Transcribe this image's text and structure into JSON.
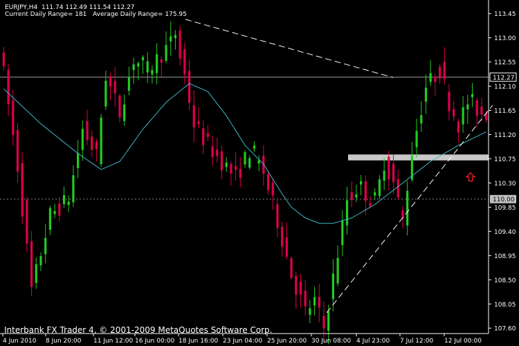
{
  "header": {
    "line1": "EURJPY,H4  111.74 112.49 111.54 112.27",
    "line2": "Current Daily Range= 181   Average Daily Range= 175.95"
  },
  "footer": {
    "copyright": "Interbank FX Trader 4, © 2001-2009 MetaQuotes Software Corp."
  },
  "colors": {
    "background": "#000000",
    "bull": "#22cc22",
    "bear": "#e0004a",
    "ma": "#3fb7c9",
    "hline": "#9a9a9a",
    "support_band": "#c8c8c8",
    "arrow": "#ff2020",
    "trendline": "#ffffff",
    "axis_text": "#ffffff"
  },
  "chart_data": {
    "type": "candlestick",
    "symbol": "EURJPY",
    "timeframe": "H4",
    "ylim": [
      107.5,
      113.6
    ],
    "y_ticks": [
      "113.45",
      "113.00",
      "112.55",
      "112.10",
      "111.65",
      "111.20",
      "110.75",
      "110.30",
      "109.85",
      "109.40",
      "108.95",
      "108.50",
      "108.05",
      "107.60"
    ],
    "x_ticks": [
      "4 Jun 2010",
      "8 Jun 20:00",
      "11 Jun 12:00",
      "16 Jun 00:00",
      "18 Jun 16:00",
      "23 Jun 04:00",
      "25 Jun 20:00",
      "30 Jun 08:00",
      "4 Jul 23:00",
      "7 Jul 12:00",
      "12 Jul 00:00"
    ],
    "current_price": "112.27",
    "level_marker": "110.00",
    "support_band": [
      110.72,
      110.83
    ],
    "price_path": [
      [
        0,
        112.9
      ],
      [
        4,
        110.6
      ],
      [
        7,
        108.3
      ],
      [
        11,
        109.7
      ],
      [
        15,
        110.0
      ],
      [
        18,
        111.3
      ],
      [
        21,
        110.8
      ],
      [
        23,
        112.3
      ],
      [
        26,
        111.6
      ],
      [
        29,
        112.6
      ],
      [
        32,
        112.4
      ],
      [
        35,
        112.7
      ],
      [
        38,
        113.0
      ],
      [
        40,
        112.3
      ],
      [
        42,
        111.4
      ],
      [
        45,
        111.0
      ],
      [
        48,
        110.7
      ],
      [
        51,
        110.4
      ],
      [
        54,
        110.9
      ],
      [
        57,
        110.5
      ],
      [
        60,
        109.6
      ],
      [
        63,
        108.6
      ],
      [
        66,
        107.9
      ],
      [
        68,
        108.1
      ],
      [
        70,
        107.6
      ],
      [
        73,
        109.0
      ],
      [
        75,
        110.0
      ],
      [
        78,
        110.2
      ],
      [
        81,
        109.9
      ],
      [
        83,
        110.7
      ],
      [
        85,
        110.3
      ],
      [
        87,
        109.6
      ],
      [
        89,
        110.9
      ],
      [
        92,
        112.1
      ],
      [
        95,
        112.4
      ],
      [
        97,
        111.8
      ],
      [
        99,
        111.4
      ],
      [
        101,
        111.8
      ],
      [
        104,
        111.6
      ]
    ],
    "moving_average": [
      [
        0,
        112.05
      ],
      [
        8,
        111.4
      ],
      [
        16,
        110.85
      ],
      [
        21,
        110.55
      ],
      [
        25,
        110.7
      ],
      [
        30,
        111.3
      ],
      [
        35,
        111.8
      ],
      [
        40,
        112.15
      ],
      [
        44,
        112.0
      ],
      [
        48,
        111.55
      ],
      [
        52,
        111.0
      ],
      [
        56,
        110.65
      ],
      [
        60,
        110.1
      ],
      [
        62,
        109.85
      ],
      [
        65,
        109.65
      ],
      [
        68,
        109.55
      ],
      [
        71,
        109.55
      ],
      [
        75,
        109.65
      ],
      [
        80,
        109.9
      ],
      [
        86,
        110.3
      ],
      [
        92,
        110.7
      ],
      [
        98,
        111.0
      ],
      [
        104,
        111.25
      ]
    ],
    "trendlines": [
      {
        "from": [
          268,
          28
        ],
        "to": [
          568,
          112
        ],
        "style": "dashed"
      },
      {
        "from": [
          472,
          452
        ],
        "to": [
          712,
          152
        ],
        "style": "dashed"
      }
    ],
    "arrow": {
      "price": 110.4,
      "direction": "up"
    }
  }
}
